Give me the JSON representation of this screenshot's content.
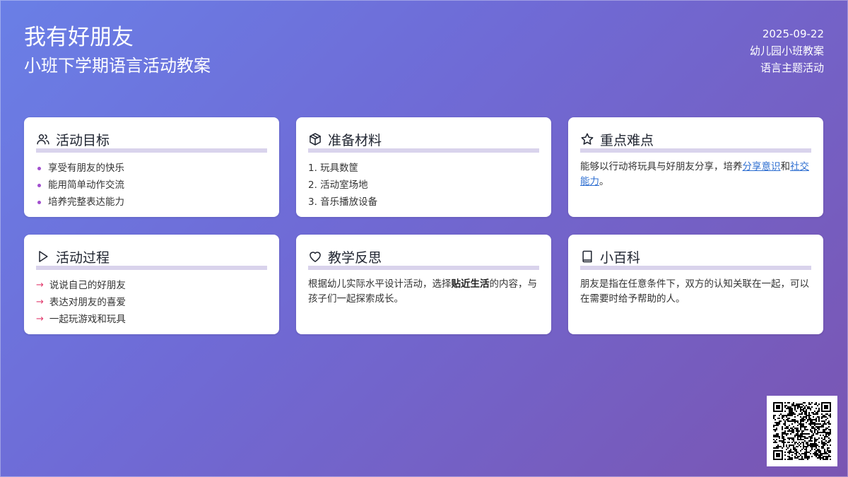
{
  "header": {
    "title": "我有好朋友",
    "subtitle": "小班下学期语言活动教案",
    "date": "2025-09-22",
    "meta_line1": "幼儿园小班教案",
    "meta_line2": "语言主题活动"
  },
  "cards": {
    "goals": {
      "title": "活动目标",
      "icon": "users-icon",
      "items": [
        "享受有朋友的快乐",
        "能用简单动作交流",
        "培养完整表达能力"
      ]
    },
    "materials": {
      "title": "准备材料",
      "icon": "box-icon",
      "items": [
        "1. 玩具数筐",
        "2. 活动室场地",
        "3. 音乐播放设备"
      ]
    },
    "keypoints": {
      "title": "重点难点",
      "icon": "star-icon",
      "text_before": "能够以行动将玩具与好朋友分享，培养",
      "link1": "分享意识",
      "text_middle": "和",
      "link2": "社交能力",
      "text_after": "。"
    },
    "process": {
      "title": "活动过程",
      "icon": "play-icon",
      "items": [
        "说说自己的好朋友",
        "表达对朋友的喜爱",
        "一起玩游戏和玩具"
      ]
    },
    "reflection": {
      "title": "教学反思",
      "icon": "heart-icon",
      "text_before": "根据幼儿实际水平设计活动，选择",
      "bold": "贴近生活",
      "text_after": "的内容，与孩子们一起探索成长。"
    },
    "encyclopedia": {
      "title": "小百科",
      "icon": "book-icon",
      "text": "朋友是指在任意条件下，双方的认知关联在一起，可以在需要时给予帮助的人。"
    }
  },
  "colors": {
    "bullet": "#a24fcf",
    "arrow": "#e23d6e",
    "link": "#2f6fd1",
    "rule": "#d9d3ec"
  }
}
